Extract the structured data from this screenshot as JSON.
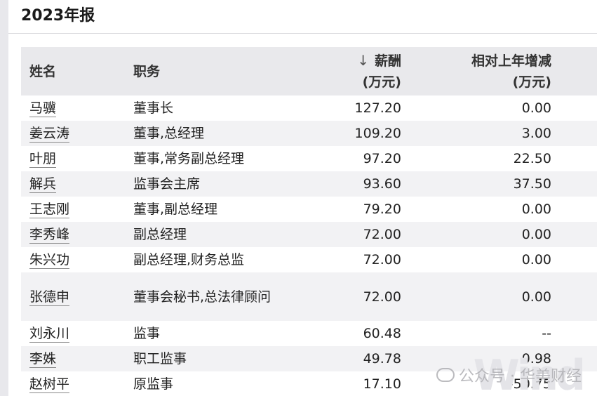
{
  "report": {
    "title": "2023年报"
  },
  "table": {
    "headers": {
      "name": "姓名",
      "position": "职务",
      "pay_line1": "薪酬",
      "pay_line2": "(万元)",
      "change_line1": "相对上年增减",
      "change_line2": "(万元)"
    },
    "sort_icon": "arrow-down-icon",
    "rows": [
      {
        "name": "马骥",
        "position": "董事长",
        "pay": "127.20",
        "change": "0.00"
      },
      {
        "name": "姜云涛",
        "position": "董事,总经理",
        "pay": "109.20",
        "change": "3.00"
      },
      {
        "name": "叶朋",
        "position": "董事,常务副总经理",
        "pay": "97.20",
        "change": "22.50"
      },
      {
        "name": "解兵",
        "position": "监事会主席",
        "pay": "93.60",
        "change": "37.50"
      },
      {
        "name": "王志刚",
        "position": "董事,副总经理",
        "pay": "79.20",
        "change": "0.00"
      },
      {
        "name": "李秀峰",
        "position": "副总经理",
        "pay": "72.00",
        "change": "0.00"
      },
      {
        "name": "朱兴功",
        "position": "副总经理,财务总监",
        "pay": "72.00",
        "change": "0.00"
      },
      {
        "name": "张德申",
        "position": "董事会秘书,总法律顾问",
        "pay": "72.00",
        "change": "0.00"
      },
      {
        "name": "刘永川",
        "position": "监事",
        "pay": "60.48",
        "change": "--"
      },
      {
        "name": "李姝",
        "position": "职工监事",
        "pay": "49.78",
        "change": "0.98"
      },
      {
        "name": "赵树平",
        "position": "原监事",
        "pay": "17.10",
        "change": "-50.75"
      }
    ]
  },
  "watermark": {
    "text": "公众号 · 华美财经",
    "logo": "Wind"
  }
}
